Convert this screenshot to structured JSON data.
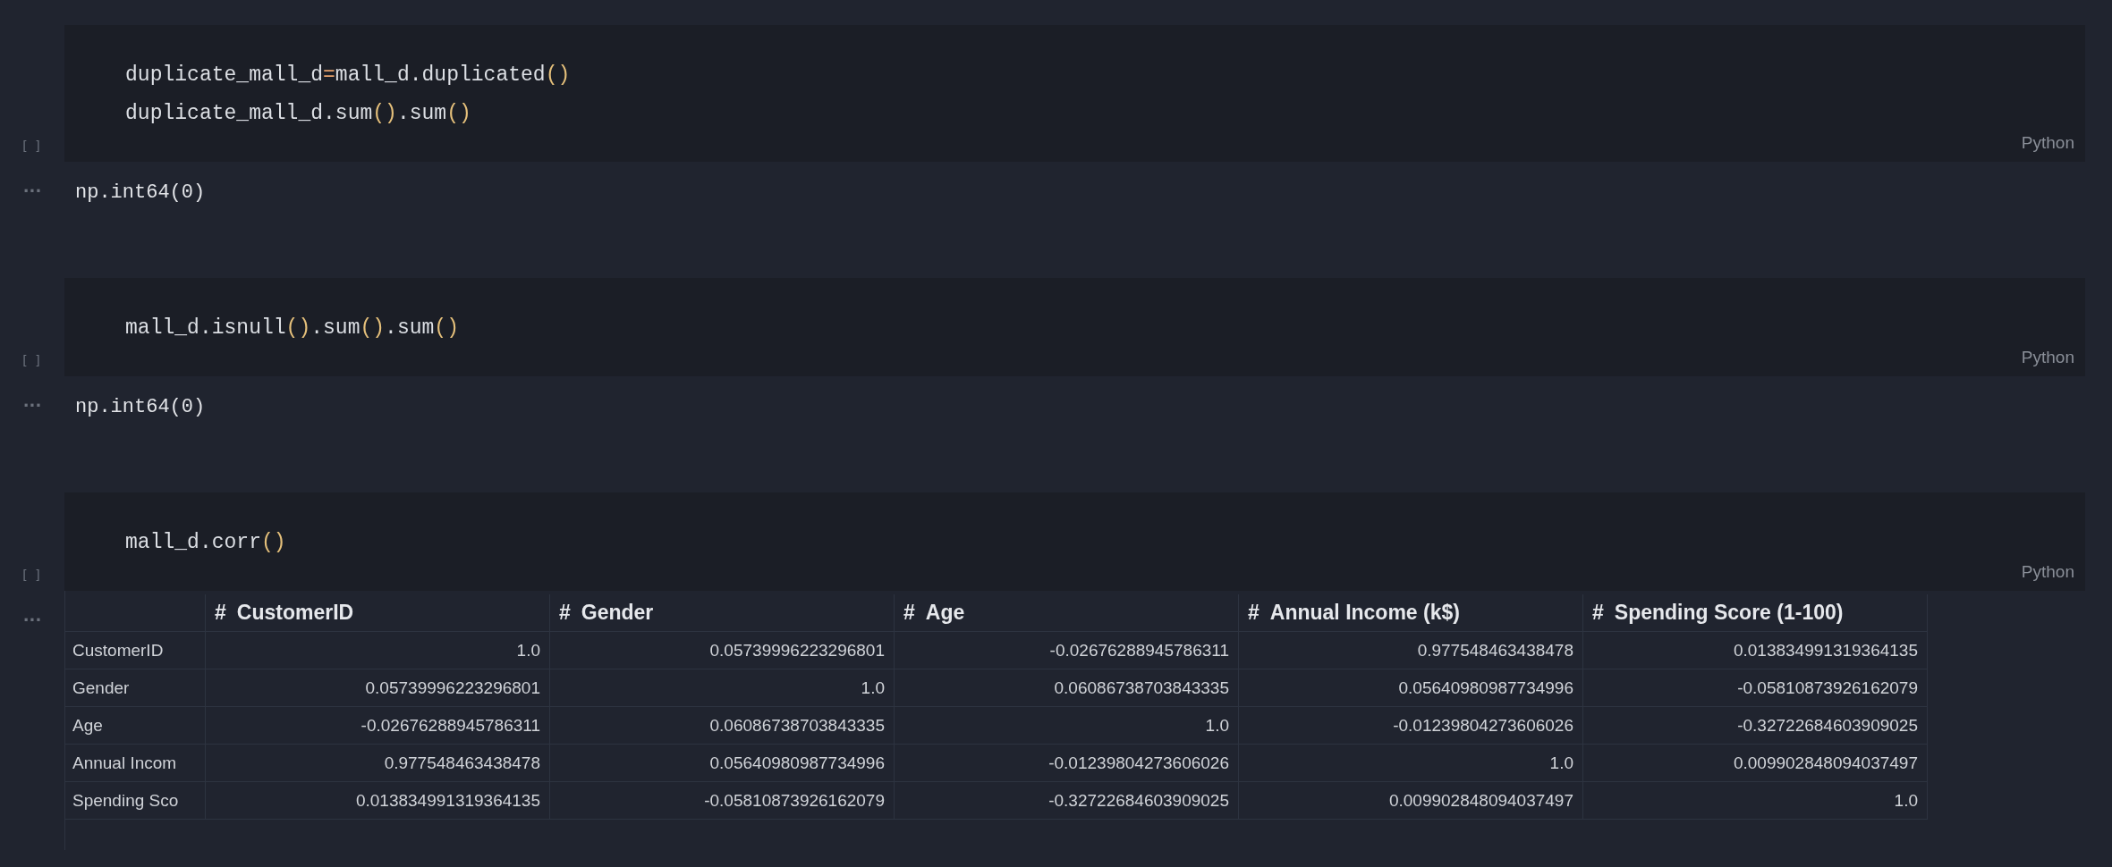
{
  "cells": [
    {
      "run_label": "[ ]",
      "language": "Python",
      "code": [
        "duplicate_mall_d=mall_d.duplicated()",
        "duplicate_mall_d.sum().sum()"
      ],
      "output_marker": "···",
      "output": {
        "kind": "text",
        "text": "np.int64(0)"
      }
    },
    {
      "run_label": "[ ]",
      "language": "Python",
      "code": [
        "mall_d.isnull().sum().sum()"
      ],
      "output_marker": "···",
      "output": {
        "kind": "text",
        "text": "np.int64(0)"
      }
    },
    {
      "run_label": "[ ]",
      "language": "Python",
      "code": [
        "mall_d.corr()"
      ],
      "output_marker": "···",
      "output": {
        "kind": "table",
        "columns": [
          {
            "marker": "#",
            "label": "CustomerID"
          },
          {
            "marker": "#",
            "label": "Gender"
          },
          {
            "marker": "#",
            "label": "Age"
          },
          {
            "marker": "#",
            "label": "Annual Income (k$)"
          },
          {
            "marker": "#",
            "label": "Spending Score (1-100)"
          }
        ],
        "rows": [
          {
            "index": "CustomerID",
            "values": [
              "1.0",
              "0.05739996223296801",
              "-0.02676288945786311",
              "0.977548463438478",
              "0.013834991319364135"
            ]
          },
          {
            "index": "Gender",
            "values": [
              "0.05739996223296801",
              "1.0",
              "0.06086738703843335",
              "0.05640980987734996",
              "-0.05810873926162079"
            ]
          },
          {
            "index": "Age",
            "values": [
              "-0.02676288945786311",
              "0.06086738703843335",
              "1.0",
              "-0.01239804273606026",
              "-0.32722684603909025"
            ]
          },
          {
            "index": "Annual Incom",
            "values": [
              "0.977548463438478",
              "0.05640980987734996",
              "-0.01239804273606026",
              "1.0",
              "0.009902848094037497"
            ]
          },
          {
            "index": "Spending Sco",
            "values": [
              "0.013834991319364135",
              "-0.05810873926162079",
              "-0.32722684603909025",
              "0.009902848094037497",
              "1.0"
            ]
          }
        ]
      }
    }
  ]
}
